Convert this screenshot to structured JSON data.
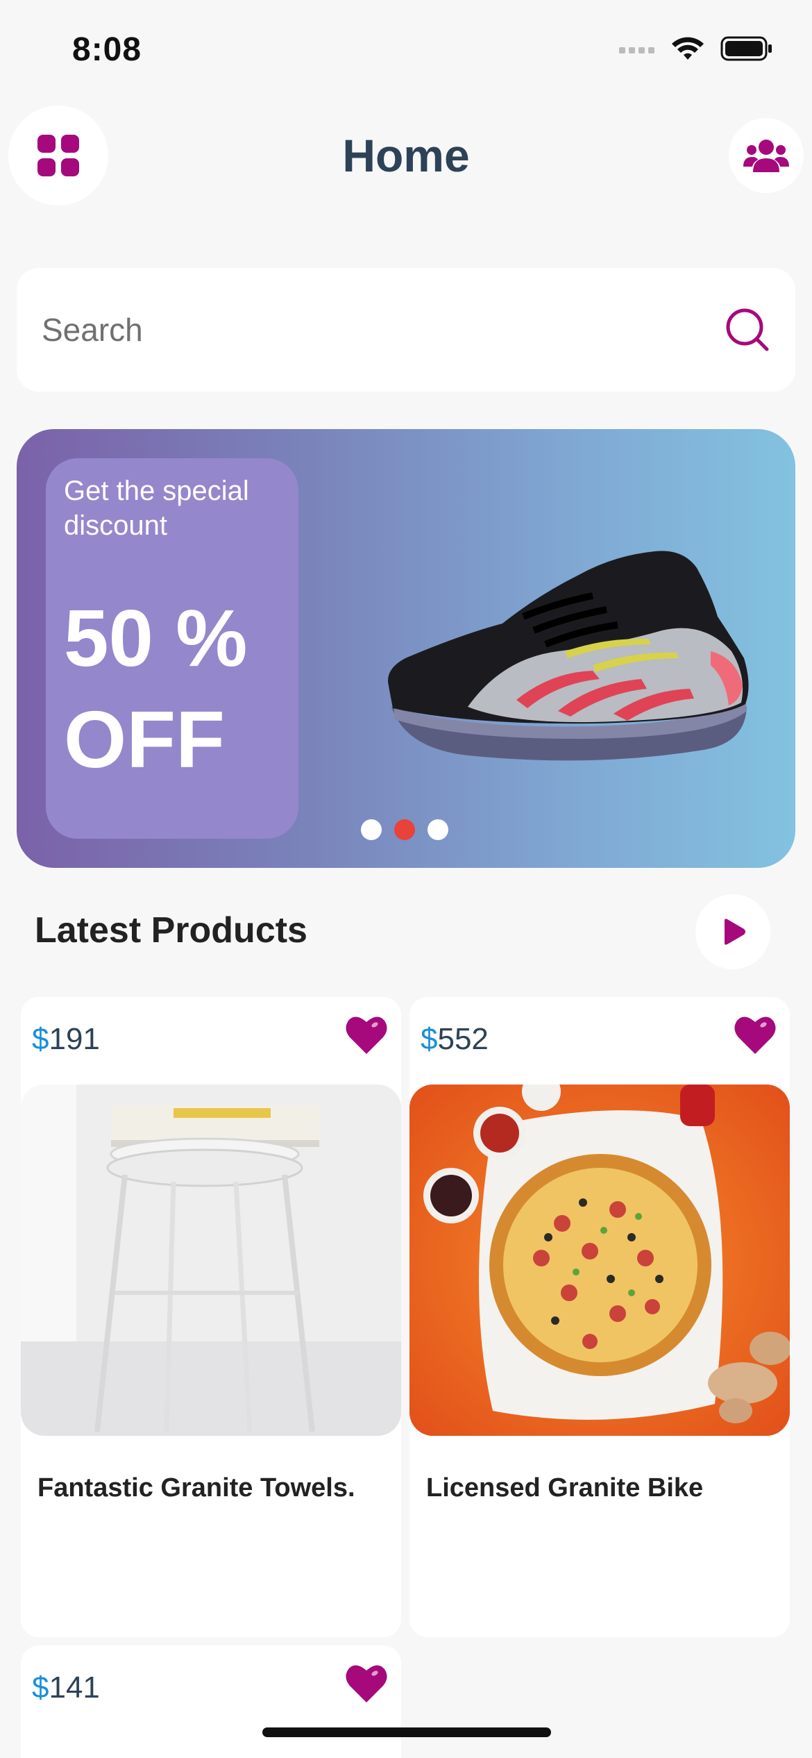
{
  "status_bar": {
    "time": "8:08"
  },
  "header": {
    "title": "Home"
  },
  "search": {
    "placeholder": "Search",
    "value": ""
  },
  "banner": {
    "subtitle": "Get the special discount",
    "headline": "50 % OFF",
    "carousel": {
      "count": 3,
      "active_index": 1
    }
  },
  "section": {
    "title": "Latest Products"
  },
  "products": [
    {
      "currency": "$",
      "price": "191",
      "name": "Fantastic Granite Towels.",
      "image": "white stool with book",
      "favorited": true
    },
    {
      "currency": "$",
      "price": "552",
      "name": "Licensed Granite Bike",
      "image": "pizza on orange table",
      "favorited": true
    },
    {
      "currency": "$",
      "price": "141",
      "name": "",
      "image": "",
      "favorited": true
    }
  ],
  "colors": {
    "accent": "#a5097c",
    "title": "#2d4257",
    "price_currency": "#1a8fd9",
    "dot_active": "#e8423a"
  },
  "icons": [
    "grid-menu-icon",
    "users-icon",
    "search-icon",
    "play-icon",
    "heart-icon",
    "signal-icon",
    "wifi-icon",
    "battery-icon"
  ]
}
